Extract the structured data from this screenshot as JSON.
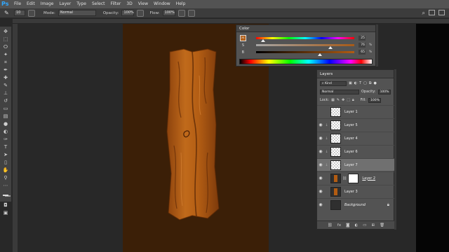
{
  "menu": {
    "logo": "Ps",
    "items": [
      "File",
      "Edit",
      "Image",
      "Layer",
      "Type",
      "Select",
      "Filter",
      "3D",
      "View",
      "Window",
      "Help"
    ]
  },
  "options": {
    "brush_size": "10",
    "mode_label": "Mode:",
    "mode_value": "Normal",
    "opacity_label": "Opacity:",
    "opacity_value": "100%",
    "flow_label": "Flow:",
    "flow_value": "100%"
  },
  "color_panel": {
    "title": "Color",
    "sliders": [
      {
        "letter": "H",
        "value": "25",
        "unit": "",
        "fraction": 0.07
      },
      {
        "letter": "S",
        "value": "76",
        "unit": "%",
        "fraction": 0.76
      },
      {
        "letter": "B",
        "value": "65",
        "unit": "%",
        "fraction": 0.65
      }
    ],
    "foreground_color": "#b25c12"
  },
  "layers_panel": {
    "title": "Layers",
    "filter_value": "Kind",
    "blend_mode": "Normal",
    "opacity_label": "Opacity:",
    "opacity_value": "100%",
    "lock_label": "Lock:",
    "fill_label": "Fill:",
    "fill_value": "100%",
    "layers": [
      {
        "name": "Layer 1",
        "visible": false,
        "thumb": "transparent",
        "selected": false,
        "linked": false
      },
      {
        "name": "Layer 5",
        "visible": true,
        "thumb": "transparent",
        "selected": false,
        "linked": true
      },
      {
        "name": "Layer 4",
        "visible": true,
        "thumb": "transparent",
        "selected": false,
        "linked": true
      },
      {
        "name": "Layer 6",
        "visible": true,
        "thumb": "transparent",
        "selected": false,
        "linked": true
      },
      {
        "name": "Layer 7",
        "visible": true,
        "thumb": "transparent",
        "selected": true,
        "linked": true
      },
      {
        "name": "Layer 2",
        "visible": true,
        "thumb": "plank",
        "selected": false,
        "linked": false
      },
      {
        "name": "Layer 3",
        "visible": true,
        "thumb": "plank",
        "selected": false,
        "linked": false
      },
      {
        "name": "Background",
        "visible": true,
        "thumb": "dark",
        "selected": false,
        "linked": false
      }
    ],
    "footer_icons": [
      "link-icon",
      "fx-icon",
      "mask-icon",
      "adjustment-icon",
      "group-icon",
      "new-layer-icon",
      "trash-icon"
    ]
  },
  "colors": {
    "doc_background": "#3b1f07",
    "wood_base": "#b25c12",
    "wood_dark": "#6e320a",
    "wood_light": "#d7862e"
  }
}
